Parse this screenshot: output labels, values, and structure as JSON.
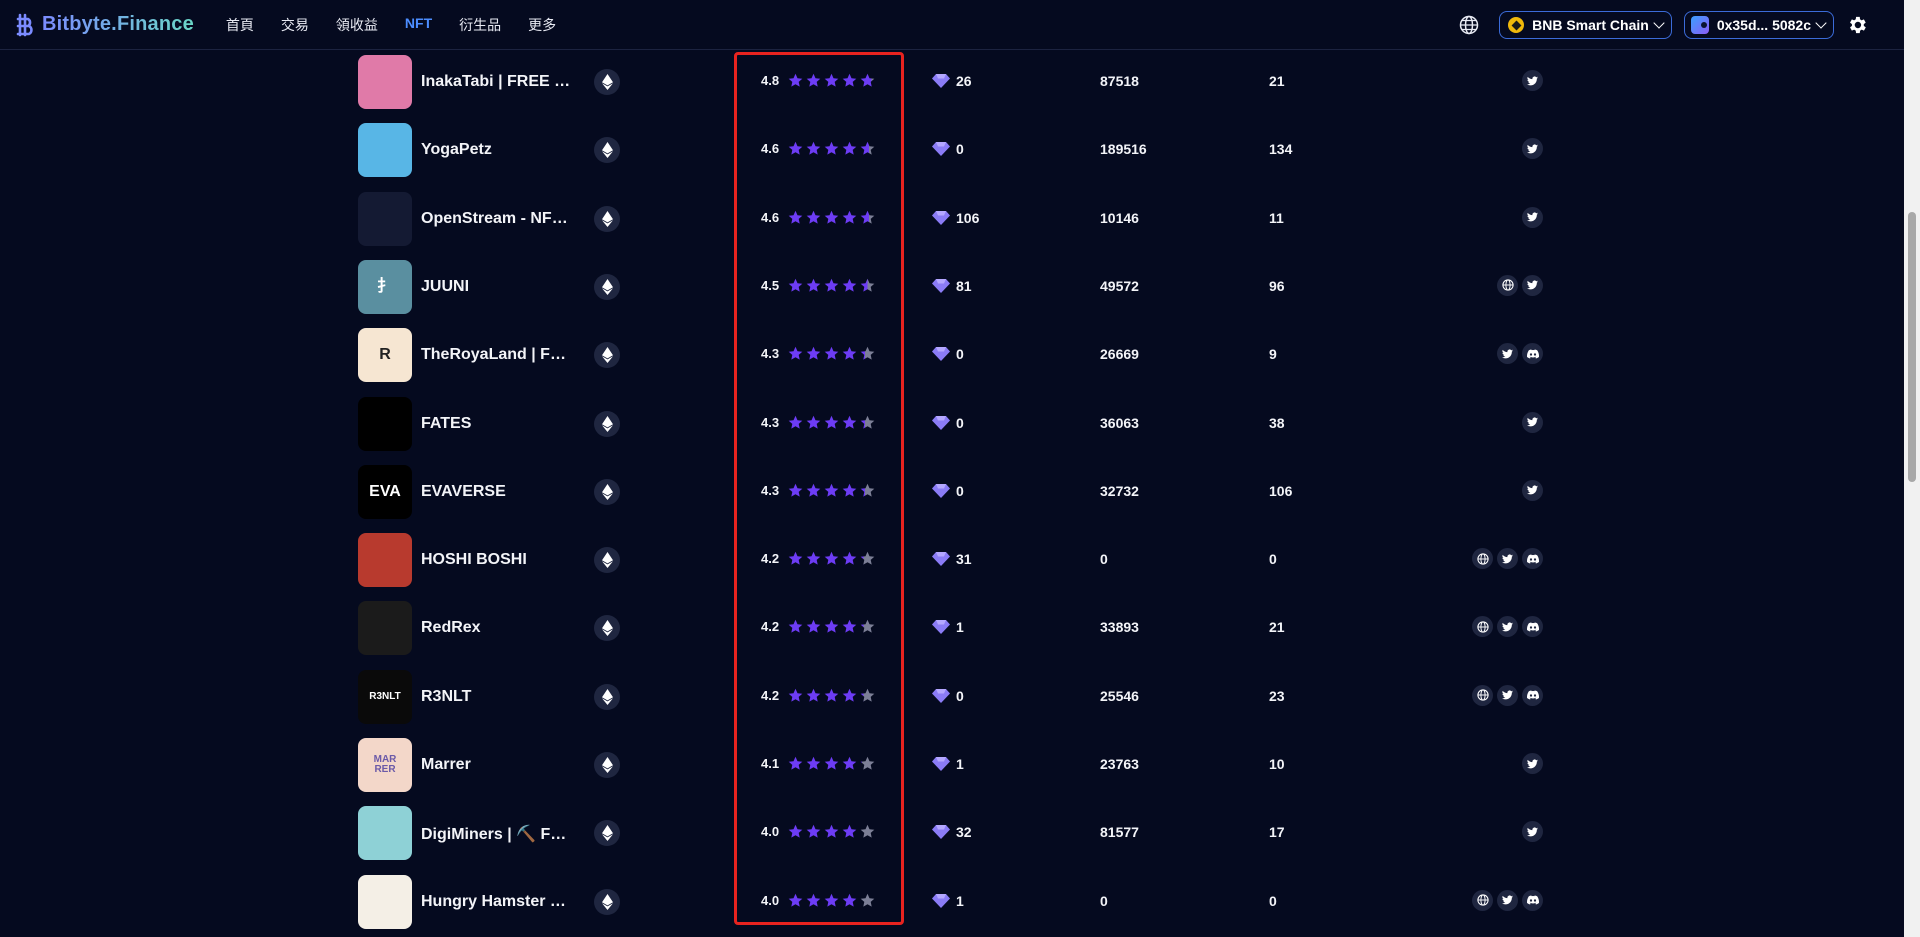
{
  "header": {
    "brand": "Bitbyte.Finance",
    "nav": [
      {
        "label": "首頁",
        "active": false
      },
      {
        "label": "交易",
        "active": false
      },
      {
        "label": "領收益",
        "active": false
      },
      {
        "label": "NFT",
        "active": true
      },
      {
        "label": "衍生品",
        "active": false
      },
      {
        "label": "更多",
        "active": false
      }
    ],
    "chain_label": "BNB Smart Chain",
    "wallet_label": "0x35d... 5082c"
  },
  "colors": {
    "background": "#050a1f",
    "accent": "#4c8dff",
    "star_filled": "#6d3cf5",
    "star_empty": "#7c7f96",
    "highlight_border": "#e8231f"
  },
  "rows": [
    {
      "name": "InakaTabi | FREE MINT",
      "rating": "4.8",
      "gem": "26",
      "col3": "87518",
      "col4": "21",
      "socials": [
        "twitter"
      ],
      "avatar": {
        "bg": "#e07aa8",
        "fg": "#ffffff",
        "text": ""
      }
    },
    {
      "name": "YogaPetz",
      "rating": "4.6",
      "gem": "0",
      "col3": "189516",
      "col4": "134",
      "socials": [
        "twitter"
      ],
      "avatar": {
        "bg": "#58b6e6",
        "fg": "#f08a2c",
        "text": ""
      }
    },
    {
      "name": "OpenStream - NFT Access",
      "rating": "4.6",
      "gem": "106",
      "col3": "10146",
      "col4": "11",
      "socials": [
        "twitter"
      ],
      "avatar": {
        "bg": "#141a33",
        "fg": "#4f46e5",
        "text": ""
      }
    },
    {
      "name": "JUUNI",
      "rating": "4.5",
      "gem": "81",
      "col3": "49572",
      "col4": "96",
      "socials": [
        "globe",
        "twitter"
      ],
      "avatar": {
        "bg": "#5a8fa0",
        "fg": "#ffffff",
        "text": "扌"
      }
    },
    {
      "name": "TheRoyaLand | FREE MINT",
      "rating": "4.3",
      "gem": "0",
      "col3": "26669",
      "col4": "9",
      "socials": [
        "twitter",
        "discord"
      ],
      "avatar": {
        "bg": "#f6e6d2",
        "fg": "#222222",
        "text": "R"
      }
    },
    {
      "name": "FATES",
      "rating": "4.3",
      "gem": "0",
      "col3": "36063",
      "col4": "38",
      "socials": [
        "twitter"
      ],
      "avatar": {
        "bg": "#000000",
        "fg": "#ffffff",
        "text": ""
      }
    },
    {
      "name": "EVAVERSE",
      "rating": "4.3",
      "gem": "0",
      "col3": "32732",
      "col4": "106",
      "socials": [
        "twitter"
      ],
      "avatar": {
        "bg": "#000000",
        "fg": "#ffffff",
        "text": "EVA"
      }
    },
    {
      "name": "HOSHI BOSHI",
      "rating": "4.2",
      "gem": "31",
      "col3": "0",
      "col4": "0",
      "socials": [
        "globe",
        "twitter",
        "discord"
      ],
      "avatar": {
        "bg": "#b83a2e",
        "fg": "#ffffff",
        "text": ""
      }
    },
    {
      "name": "RedRex",
      "rating": "4.2",
      "gem": "1",
      "col3": "33893",
      "col4": "21",
      "socials": [
        "globe",
        "twitter",
        "discord"
      ],
      "avatar": {
        "bg": "#1b1b1b",
        "fg": "#e41f3a",
        "text": ""
      }
    },
    {
      "name": "R3NLT",
      "rating": "4.2",
      "gem": "0",
      "col3": "25546",
      "col4": "23",
      "socials": [
        "globe",
        "twitter",
        "discord"
      ],
      "avatar": {
        "bg": "#0a0a0a",
        "fg": "#ffffff",
        "text": "R3NLT"
      }
    },
    {
      "name": "Marrer",
      "rating": "4.1",
      "gem": "1",
      "col3": "23763",
      "col4": "10",
      "socials": [
        "twitter"
      ],
      "avatar": {
        "bg": "#f3d7c9",
        "fg": "#6b5aa8",
        "text": "MAR\nRER"
      }
    },
    {
      "name": "DigiMiners | ⛏️ FREE MINT",
      "rating": "4.0",
      "gem": "32",
      "col3": "81577",
      "col4": "17",
      "socials": [
        "twitter"
      ],
      "avatar": {
        "bg": "#8ed1d6",
        "fg": "#3a2a1a",
        "text": ""
      }
    },
    {
      "name": "Hungry Hamster Club",
      "rating": "4.0",
      "gem": "1",
      "col3": "0",
      "col4": "0",
      "socials": [
        "globe",
        "twitter",
        "discord"
      ],
      "avatar": {
        "bg": "#f4efe6",
        "fg": "#d98b3a",
        "text": ""
      }
    }
  ]
}
